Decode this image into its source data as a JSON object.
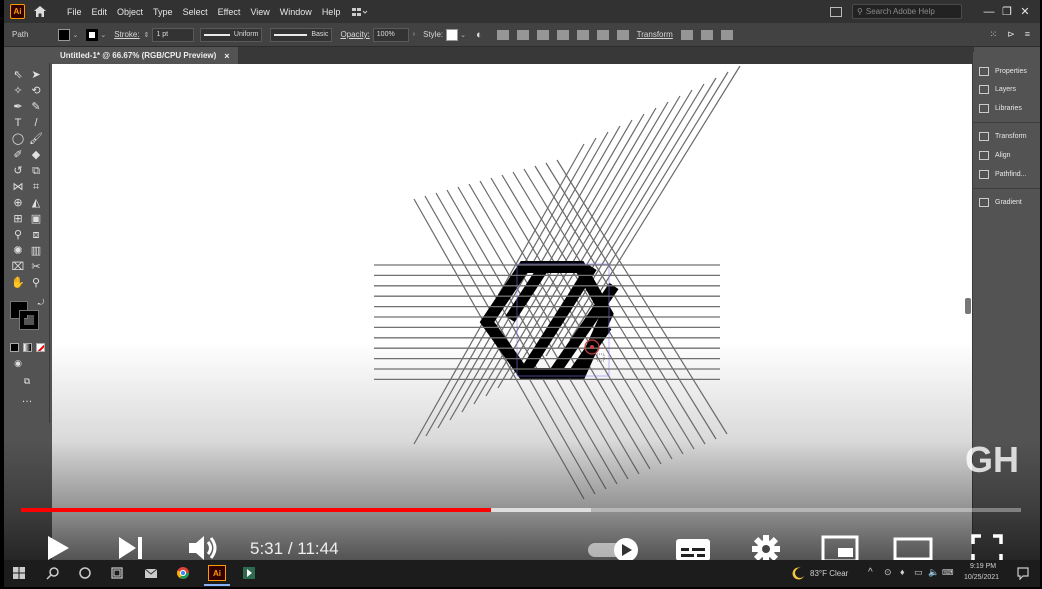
{
  "app": {
    "logo": "Ai",
    "menu": [
      "File",
      "Edit",
      "Object",
      "Type",
      "Select",
      "Effect",
      "View",
      "Window",
      "Help"
    ],
    "search_placeholder": "Search Adobe Help"
  },
  "controlbar": {
    "selection_type": "Path",
    "stroke_label": "Stroke:",
    "stroke_weight": "1 pt",
    "profile": "Uniform",
    "brush": "Basic",
    "opacity_label": "Opacity:",
    "opacity_value": "100%",
    "style_label": "Style:",
    "transform_label": "Transform"
  },
  "document": {
    "tab_title": "Untitled-1* @ 66.67% (RGB/CPU Preview)",
    "close_glyph": "×"
  },
  "panels": {
    "items": [
      "Properties",
      "Layers",
      "Libraries",
      "Transform",
      "Align",
      "Pathfind...",
      "Gradient"
    ]
  },
  "colors": {
    "accent_red": "#ff0000",
    "ai_orange": "#ff9a00",
    "chrome_dark": "#323232",
    "chrome_mid": "#535353"
  },
  "video": {
    "current_time": "5:31",
    "separator": " / ",
    "duration": "11:44",
    "played_fraction": 0.47,
    "buffered_fraction": 0.57,
    "watermark": "GH"
  },
  "taskbar": {
    "weather": "83°F  Clear",
    "time": "9:19 PM",
    "date": "10/25/2021"
  }
}
